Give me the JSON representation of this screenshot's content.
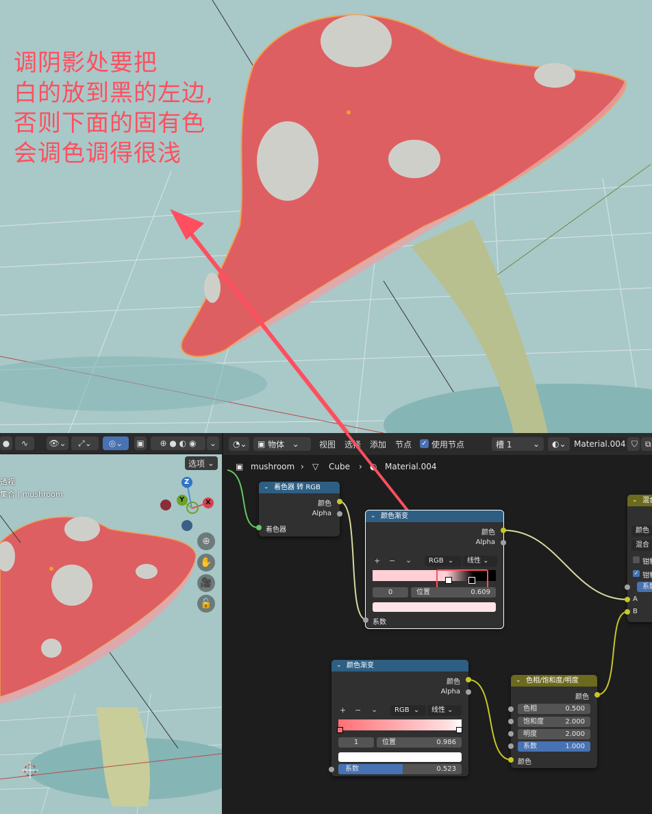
{
  "annotation": {
    "lines": [
      "调阴影处要把",
      "白的放到黑的左边,",
      "否则下面的固有色",
      "会调色调得很浅"
    ],
    "color": "#ff4f5f"
  },
  "viewport": {
    "options_label": "选项",
    "view_text": "透视",
    "collection_text": "集合 | mushroom",
    "gizmo": {
      "z": "Z",
      "y": "Y",
      "x": "X"
    },
    "nav_icons": [
      "zoom-icon",
      "hand-icon",
      "camera-icon",
      "lock-icon"
    ]
  },
  "node_header": {
    "object_mode": "物体",
    "menu": [
      "视图",
      "选择",
      "添加",
      "节点"
    ],
    "use_nodes_label": "使用节点",
    "slot": "槽 1",
    "material": "Material.004"
  },
  "breadcrumb": {
    "items": [
      "mushroom",
      "Cube",
      "Material.004"
    ]
  },
  "nodes": {
    "shader_to_rgb": {
      "title": "着色器 转 RGB",
      "out_color": "颜色",
      "out_alpha": "Alpha",
      "in_shader": "着色器"
    },
    "color_ramp_1": {
      "title": "颜色渐变",
      "out_color": "颜色",
      "out_alpha": "Alpha",
      "plus": "+",
      "minus": "−",
      "chev": "⌄",
      "mode": "RGB",
      "interp": "线性",
      "index": "0",
      "pos_label": "位置",
      "pos_value": "0.609",
      "in_fac": "系数",
      "swatch": "#ffe3e6"
    },
    "color_ramp_2": {
      "title": "颜色渐变",
      "out_color": "颜色",
      "out_alpha": "Alpha",
      "plus": "+",
      "minus": "−",
      "chev": "⌄",
      "mode": "RGB",
      "interp": "线性",
      "index": "1",
      "pos_label": "位置",
      "pos_value": "0.986",
      "in_fac": "系数",
      "fac_value": "0.523",
      "fac_fraction": 0.523,
      "swatch": "#ffffff"
    },
    "hsv": {
      "title": "色相/饱和度/明度",
      "out_color": "颜色",
      "hue_label": "色相",
      "hue_value": "0.500",
      "sat_label": "饱和度",
      "sat_value": "2.000",
      "val_label": "明度",
      "val_value": "2.000",
      "fac_label": "系数",
      "fac_value": "1.000",
      "in_color": "颜色"
    },
    "mix": {
      "title": "混合",
      "color_mode": "颜色",
      "blend_mode": "混合",
      "clamp1": "钳制",
      "clamp2": "钳制",
      "fac": "系数",
      "a": "A",
      "b": "B"
    }
  }
}
